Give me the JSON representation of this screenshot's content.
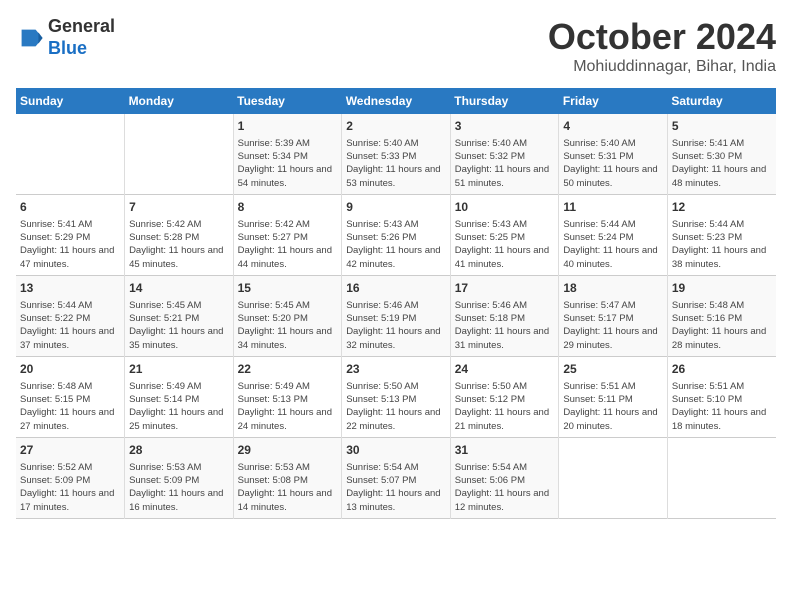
{
  "header": {
    "logo_line1": "General",
    "logo_line2": "Blue",
    "month_title": "October 2024",
    "subtitle": "Mohiuddinnagar, Bihar, India"
  },
  "days_of_week": [
    "Sunday",
    "Monday",
    "Tuesday",
    "Wednesday",
    "Thursday",
    "Friday",
    "Saturday"
  ],
  "weeks": [
    [
      {
        "day": "",
        "data": ""
      },
      {
        "day": "",
        "data": ""
      },
      {
        "day": "1",
        "data": "Sunrise: 5:39 AM\nSunset: 5:34 PM\nDaylight: 11 hours and 54 minutes."
      },
      {
        "day": "2",
        "data": "Sunrise: 5:40 AM\nSunset: 5:33 PM\nDaylight: 11 hours and 53 minutes."
      },
      {
        "day": "3",
        "data": "Sunrise: 5:40 AM\nSunset: 5:32 PM\nDaylight: 11 hours and 51 minutes."
      },
      {
        "day": "4",
        "data": "Sunrise: 5:40 AM\nSunset: 5:31 PM\nDaylight: 11 hours and 50 minutes."
      },
      {
        "day": "5",
        "data": "Sunrise: 5:41 AM\nSunset: 5:30 PM\nDaylight: 11 hours and 48 minutes."
      }
    ],
    [
      {
        "day": "6",
        "data": "Sunrise: 5:41 AM\nSunset: 5:29 PM\nDaylight: 11 hours and 47 minutes."
      },
      {
        "day": "7",
        "data": "Sunrise: 5:42 AM\nSunset: 5:28 PM\nDaylight: 11 hours and 45 minutes."
      },
      {
        "day": "8",
        "data": "Sunrise: 5:42 AM\nSunset: 5:27 PM\nDaylight: 11 hours and 44 minutes."
      },
      {
        "day": "9",
        "data": "Sunrise: 5:43 AM\nSunset: 5:26 PM\nDaylight: 11 hours and 42 minutes."
      },
      {
        "day": "10",
        "data": "Sunrise: 5:43 AM\nSunset: 5:25 PM\nDaylight: 11 hours and 41 minutes."
      },
      {
        "day": "11",
        "data": "Sunrise: 5:44 AM\nSunset: 5:24 PM\nDaylight: 11 hours and 40 minutes."
      },
      {
        "day": "12",
        "data": "Sunrise: 5:44 AM\nSunset: 5:23 PM\nDaylight: 11 hours and 38 minutes."
      }
    ],
    [
      {
        "day": "13",
        "data": "Sunrise: 5:44 AM\nSunset: 5:22 PM\nDaylight: 11 hours and 37 minutes."
      },
      {
        "day": "14",
        "data": "Sunrise: 5:45 AM\nSunset: 5:21 PM\nDaylight: 11 hours and 35 minutes."
      },
      {
        "day": "15",
        "data": "Sunrise: 5:45 AM\nSunset: 5:20 PM\nDaylight: 11 hours and 34 minutes."
      },
      {
        "day": "16",
        "data": "Sunrise: 5:46 AM\nSunset: 5:19 PM\nDaylight: 11 hours and 32 minutes."
      },
      {
        "day": "17",
        "data": "Sunrise: 5:46 AM\nSunset: 5:18 PM\nDaylight: 11 hours and 31 minutes."
      },
      {
        "day": "18",
        "data": "Sunrise: 5:47 AM\nSunset: 5:17 PM\nDaylight: 11 hours and 29 minutes."
      },
      {
        "day": "19",
        "data": "Sunrise: 5:48 AM\nSunset: 5:16 PM\nDaylight: 11 hours and 28 minutes."
      }
    ],
    [
      {
        "day": "20",
        "data": "Sunrise: 5:48 AM\nSunset: 5:15 PM\nDaylight: 11 hours and 27 minutes."
      },
      {
        "day": "21",
        "data": "Sunrise: 5:49 AM\nSunset: 5:14 PM\nDaylight: 11 hours and 25 minutes."
      },
      {
        "day": "22",
        "data": "Sunrise: 5:49 AM\nSunset: 5:13 PM\nDaylight: 11 hours and 24 minutes."
      },
      {
        "day": "23",
        "data": "Sunrise: 5:50 AM\nSunset: 5:13 PM\nDaylight: 11 hours and 22 minutes."
      },
      {
        "day": "24",
        "data": "Sunrise: 5:50 AM\nSunset: 5:12 PM\nDaylight: 11 hours and 21 minutes."
      },
      {
        "day": "25",
        "data": "Sunrise: 5:51 AM\nSunset: 5:11 PM\nDaylight: 11 hours and 20 minutes."
      },
      {
        "day": "26",
        "data": "Sunrise: 5:51 AM\nSunset: 5:10 PM\nDaylight: 11 hours and 18 minutes."
      }
    ],
    [
      {
        "day": "27",
        "data": "Sunrise: 5:52 AM\nSunset: 5:09 PM\nDaylight: 11 hours and 17 minutes."
      },
      {
        "day": "28",
        "data": "Sunrise: 5:53 AM\nSunset: 5:09 PM\nDaylight: 11 hours and 16 minutes."
      },
      {
        "day": "29",
        "data": "Sunrise: 5:53 AM\nSunset: 5:08 PM\nDaylight: 11 hours and 14 minutes."
      },
      {
        "day": "30",
        "data": "Sunrise: 5:54 AM\nSunset: 5:07 PM\nDaylight: 11 hours and 13 minutes."
      },
      {
        "day": "31",
        "data": "Sunrise: 5:54 AM\nSunset: 5:06 PM\nDaylight: 11 hours and 12 minutes."
      },
      {
        "day": "",
        "data": ""
      },
      {
        "day": "",
        "data": ""
      }
    ]
  ]
}
